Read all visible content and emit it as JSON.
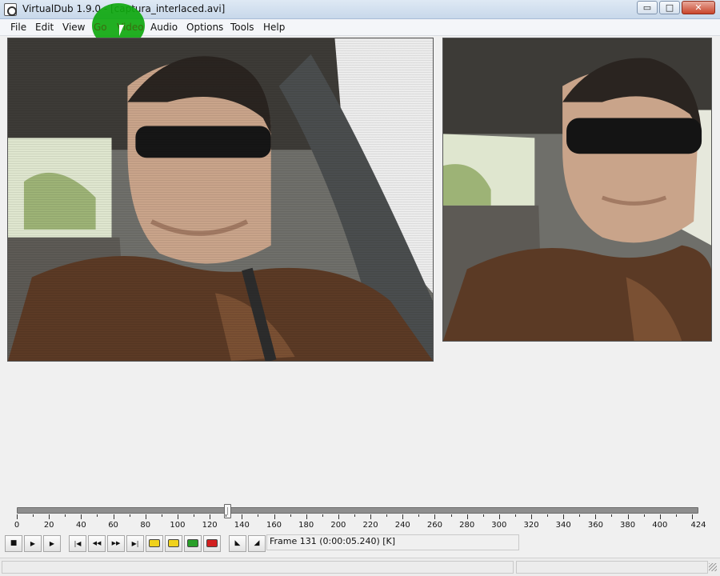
{
  "window": {
    "title": "VirtualDub 1.9.0 - [captura_interlaced.avi]",
    "min_label": "▭",
    "max_label": "□",
    "close_label": "✕"
  },
  "menu": [
    "File",
    "Edit",
    "View",
    "Go",
    "Video",
    "Audio",
    "Options",
    "Tools",
    "Help"
  ],
  "timeline": {
    "min": 0,
    "max": 424,
    "current_frame": 131,
    "tick_labels": [
      "0",
      "20",
      "40",
      "60",
      "80",
      "100",
      "120",
      "140",
      "160",
      "180",
      "200",
      "220",
      "240",
      "260",
      "280",
      "300",
      "320",
      "340",
      "360",
      "380",
      "400",
      "424"
    ],
    "tick_values": [
      0,
      20,
      40,
      60,
      80,
      100,
      120,
      140,
      160,
      180,
      200,
      220,
      240,
      260,
      280,
      300,
      320,
      340,
      360,
      380,
      400,
      424
    ]
  },
  "frame_display": "Frame 131 (0:00:05.240) [K]",
  "toolbar": {
    "buttons": [
      {
        "name": "stop-button",
        "glyph": "■"
      },
      {
        "name": "play-input-button",
        "glyph": "▶"
      },
      {
        "name": "play-output-button",
        "glyph": "▶"
      },
      {
        "name": "start-button",
        "glyph": "|◀"
      },
      {
        "name": "prev-frame-button",
        "glyph": "◀◀"
      },
      {
        "name": "next-frame-button",
        "glyph": "▶▶"
      },
      {
        "name": "end-button",
        "glyph": "▶|"
      },
      {
        "name": "prev-key-button",
        "glyph": "key"
      },
      {
        "name": "next-key-button",
        "glyph": "key"
      },
      {
        "name": "scene-back-button",
        "glyph": "scene"
      },
      {
        "name": "scene-fwd-button",
        "glyph": "scene"
      },
      {
        "name": "mark-in-button",
        "glyph": "◣"
      },
      {
        "name": "mark-out-button",
        "glyph": "◢"
      }
    ]
  },
  "colors": {
    "highlight": "#0fa80f",
    "timeline_track": "#8e8e8e"
  }
}
